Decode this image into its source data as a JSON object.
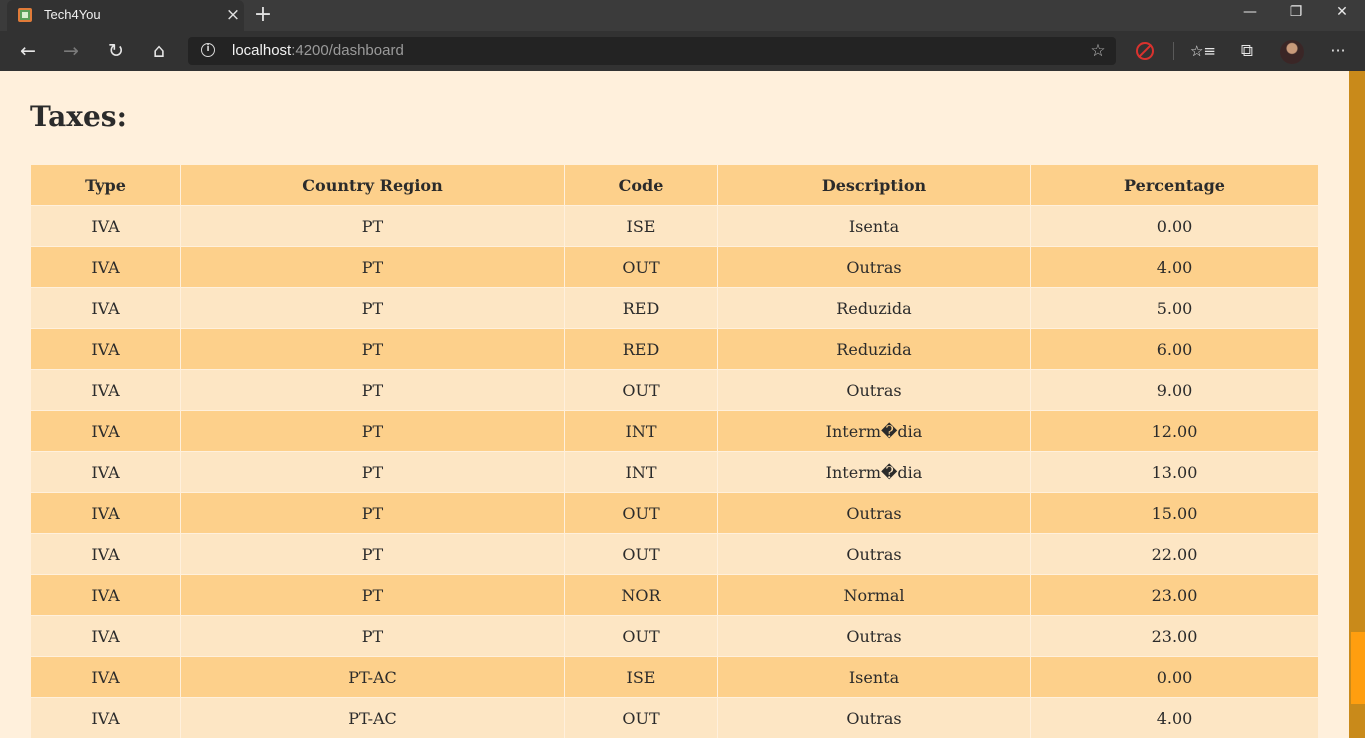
{
  "browser": {
    "tab_title": "Tech4You",
    "tab_close": "×",
    "new_tab": "+",
    "window": {
      "minimize": "—",
      "restore": "❐",
      "close": "✕"
    },
    "nav": {
      "back": "←",
      "forward": "→",
      "reload": "↻",
      "home": "⌂"
    },
    "address": {
      "host": "localhost",
      "path": ":4200/dashboard",
      "info": "i",
      "star": "☆"
    },
    "toolbar_icons": {
      "favorites": "☆≡",
      "collections": "⧉",
      "more": "···"
    }
  },
  "page": {
    "title": "Taxes:",
    "table": {
      "headers": [
        "Type",
        "Country Region",
        "Code",
        "Description",
        "Percentage"
      ],
      "rows": [
        [
          "IVA",
          "PT",
          "ISE",
          "Isenta",
          "0.00"
        ],
        [
          "IVA",
          "PT",
          "OUT",
          "Outras",
          "4.00"
        ],
        [
          "IVA",
          "PT",
          "RED",
          "Reduzida",
          "5.00"
        ],
        [
          "IVA",
          "PT",
          "RED",
          "Reduzida",
          "6.00"
        ],
        [
          "IVA",
          "PT",
          "OUT",
          "Outras",
          "9.00"
        ],
        [
          "IVA",
          "PT",
          "INT",
          "Interm�dia",
          "12.00"
        ],
        [
          "IVA",
          "PT",
          "INT",
          "Interm�dia",
          "13.00"
        ],
        [
          "IVA",
          "PT",
          "OUT",
          "Outras",
          "15.00"
        ],
        [
          "IVA",
          "PT",
          "OUT",
          "Outras",
          "22.00"
        ],
        [
          "IVA",
          "PT",
          "NOR",
          "Normal",
          "23.00"
        ],
        [
          "IVA",
          "PT",
          "OUT",
          "Outras",
          "23.00"
        ],
        [
          "IVA",
          "PT-AC",
          "ISE",
          "Isenta",
          "0.00"
        ],
        [
          "IVA",
          "PT-AC",
          "OUT",
          "Outras",
          "4.00"
        ]
      ]
    }
  },
  "colors": {
    "page_bg": "#fff0dc",
    "header_row": "#fdd08b",
    "row_light": "#fde6c4",
    "row_dark": "#fdd08b",
    "scrollbar_thumb": "#ff9e0f"
  }
}
